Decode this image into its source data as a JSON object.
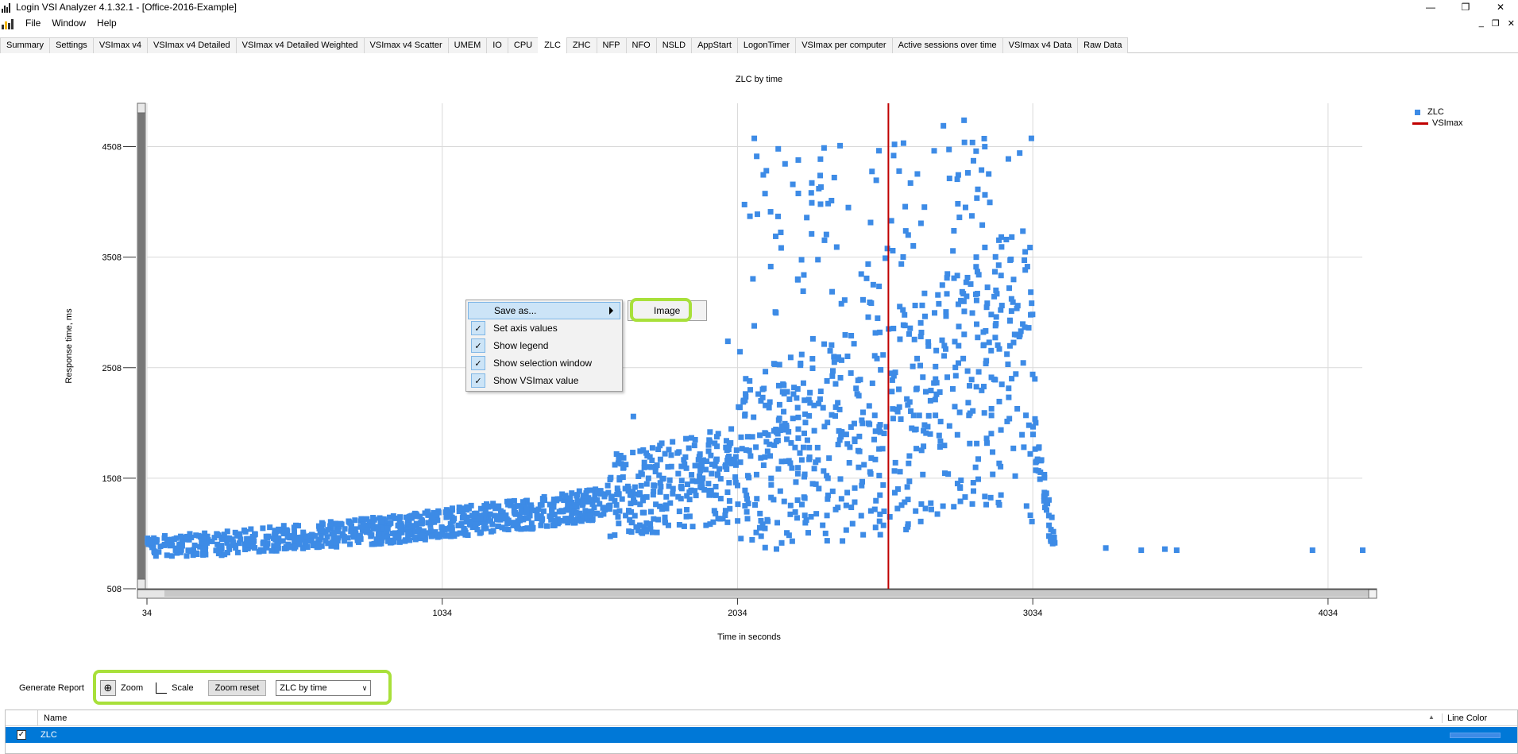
{
  "window": {
    "title": "Login VSI Analyzer 4.1.32.1 - [Office-2016-Example]",
    "controls": [
      "—",
      "❐",
      "✕"
    ],
    "mdi_controls": [
      "_",
      "❐",
      "✕"
    ]
  },
  "menu": {
    "items": [
      "File",
      "Window",
      "Help"
    ]
  },
  "tabs": [
    "Summary",
    "Settings",
    "VSImax v4",
    "VSImax v4 Detailed",
    "VSImax v4 Detailed Weighted",
    "VSImax v4 Scatter",
    "UMEM",
    "IO",
    "CPU",
    "ZLC",
    "ZHC",
    "NFP",
    "NFO",
    "NSLD",
    "AppStart",
    "LogonTimer",
    "VSImax per computer",
    "Active sessions over time",
    "VSImax v4 Data",
    "Raw Data"
  ],
  "active_tab": "ZLC",
  "chart_data": {
    "type": "scatter",
    "title": "ZLC by time",
    "xlabel": "Time in seconds",
    "ylabel": "Response time, ms",
    "xlim": [
      34,
      4150
    ],
    "ylim": [
      508,
      4900
    ],
    "xticks": [
      34,
      1034,
      2034,
      3034,
      4034
    ],
    "yticks": [
      508,
      1508,
      2508,
      3508,
      4508
    ],
    "grid": true,
    "legend_position": "top-right",
    "vline": {
      "name": "VSImax",
      "x": 2545,
      "color": "#c00000"
    },
    "series": [
      {
        "name": "ZLC",
        "color": "#3d8be6",
        "marker": "square",
        "trend": [
          [
            34,
            860
          ],
          [
            300,
            900
          ],
          [
            600,
            970
          ],
          [
            900,
            1030
          ],
          [
            1034,
            1080
          ],
          [
            1300,
            1150
          ],
          [
            1600,
            1270
          ],
          [
            1800,
            1360
          ],
          [
            2034,
            1480
          ],
          [
            2300,
            1620
          ],
          [
            2545,
            1800
          ],
          [
            2800,
            2100
          ],
          [
            3000,
            2300
          ],
          [
            3080,
            1200
          ],
          [
            3110,
            860
          ]
        ],
        "outliers": [
          [
            3280,
            880
          ],
          [
            3400,
            860
          ],
          [
            3480,
            870
          ],
          [
            3520,
            860
          ],
          [
            3980,
            860
          ],
          [
            4150,
            860
          ],
          [
            2000,
            2750
          ],
          [
            2100,
            3900
          ],
          [
            2170,
            3880
          ],
          [
            2220,
            4170
          ],
          [
            2380,
            4520
          ],
          [
            2580,
            4290
          ],
          [
            2800,
            4750
          ],
          [
            2730,
            4700
          ],
          [
            2950,
            4400
          ],
          [
            1680,
            2070
          ]
        ]
      }
    ]
  },
  "legend": {
    "items": [
      "ZLC",
      "VSImax"
    ]
  },
  "context_menu": {
    "items": [
      {
        "label": "Save as...",
        "checked": false,
        "submenu": true,
        "highlighted": true
      },
      {
        "label": "Set axis values",
        "checked": true
      },
      {
        "label": "Show legend",
        "checked": true
      },
      {
        "label": "Show selection window",
        "checked": true
      },
      {
        "label": "Show VSImax value",
        "checked": true
      }
    ],
    "submenu": {
      "items": [
        "Image"
      ]
    }
  },
  "toolbar": {
    "generate_report": "Generate Report",
    "zoom_label": "Zoom",
    "scale_label": "Scale",
    "zoom_reset": "Zoom reset",
    "chart_select": "ZLC by time"
  },
  "table": {
    "columns": [
      "Name",
      "Line Color"
    ],
    "rows": [
      {
        "checked": true,
        "name": "ZLC",
        "color": "#3d8be6"
      }
    ]
  }
}
